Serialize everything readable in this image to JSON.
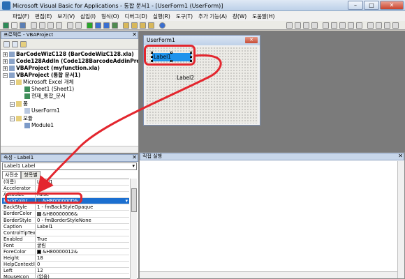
{
  "window": {
    "title": "Microsoft Visual Basic for Applications - 통합 문서1 - [UserForm1 (UserForm)]"
  },
  "menu": [
    "파일(F)",
    "편집(E)",
    "보기(V)",
    "삽입(I)",
    "형식(O)",
    "디버그(D)",
    "실행(R)",
    "도구(T)",
    "추가 기능(A)",
    "창(W)",
    "도움말(H)"
  ],
  "project_panel": {
    "title": "프로젝트 - VBAProject",
    "tree": [
      {
        "label": "BarCodeWizC128 (BarCodeWizC128.xla)",
        "bold": true
      },
      {
        "label": "Code128AddIn (Code128BarcodeAddinPrepende",
        "bold": true
      },
      {
        "label": "VBAProject (myfunction.xla)",
        "bold": true
      },
      {
        "label": "VBAProject (통합 문서1)",
        "bold": true
      },
      {
        "label": "Microsoft Excel 개체",
        "bold": false
      },
      {
        "label": "Sheet1 (Sheet1)",
        "bold": false
      },
      {
        "label": "현재_통합_문서",
        "bold": false
      },
      {
        "label": "폼",
        "bold": false
      },
      {
        "label": "UserForm1",
        "bold": false
      },
      {
        "label": "모듈",
        "bold": false
      },
      {
        "label": "Module1",
        "bold": false
      }
    ]
  },
  "form_designer": {
    "form_title": "UserForm1",
    "label1": "Label1",
    "label2": "Label2"
  },
  "properties_panel": {
    "title": "속성 - Label1",
    "object": "Label1 Label",
    "tab_alpha": "사전순",
    "tab_category": "항목별",
    "rows": [
      {
        "name": "(이름)",
        "value": "Label1"
      },
      {
        "name": "Accelerator",
        "value": ""
      },
      {
        "name": "AutoSize",
        "value": "False"
      },
      {
        "name": "BackColor",
        "value": "&H8000000D&",
        "swatch": "#1b6fd0",
        "selected": true
      },
      {
        "name": "BackStyle",
        "value": "1 - fmBackStyleOpaque"
      },
      {
        "name": "BorderColor",
        "value": "&H80000006&",
        "swatch": "#555555"
      },
      {
        "name": "BorderStyle",
        "value": "0 - fmBorderStyleNone"
      },
      {
        "name": "Caption",
        "value": "Label1"
      },
      {
        "name": "ControlTipText",
        "value": ""
      },
      {
        "name": "Enabled",
        "value": "True"
      },
      {
        "name": "Font",
        "value": "굴림"
      },
      {
        "name": "ForeColor",
        "value": "&H80000012&",
        "swatch": "#000000"
      },
      {
        "name": "Height",
        "value": "18"
      },
      {
        "name": "HelpContextID",
        "value": "0"
      },
      {
        "name": "Left",
        "value": "12"
      },
      {
        "name": "MouseIcon",
        "value": "(없음)"
      },
      {
        "name": "MousePointer",
        "value": "0 - fmMousePointerDefault"
      }
    ]
  },
  "immediate_panel": {
    "title": "직접 실행"
  },
  "annotation": {
    "color": "#e3262e"
  }
}
